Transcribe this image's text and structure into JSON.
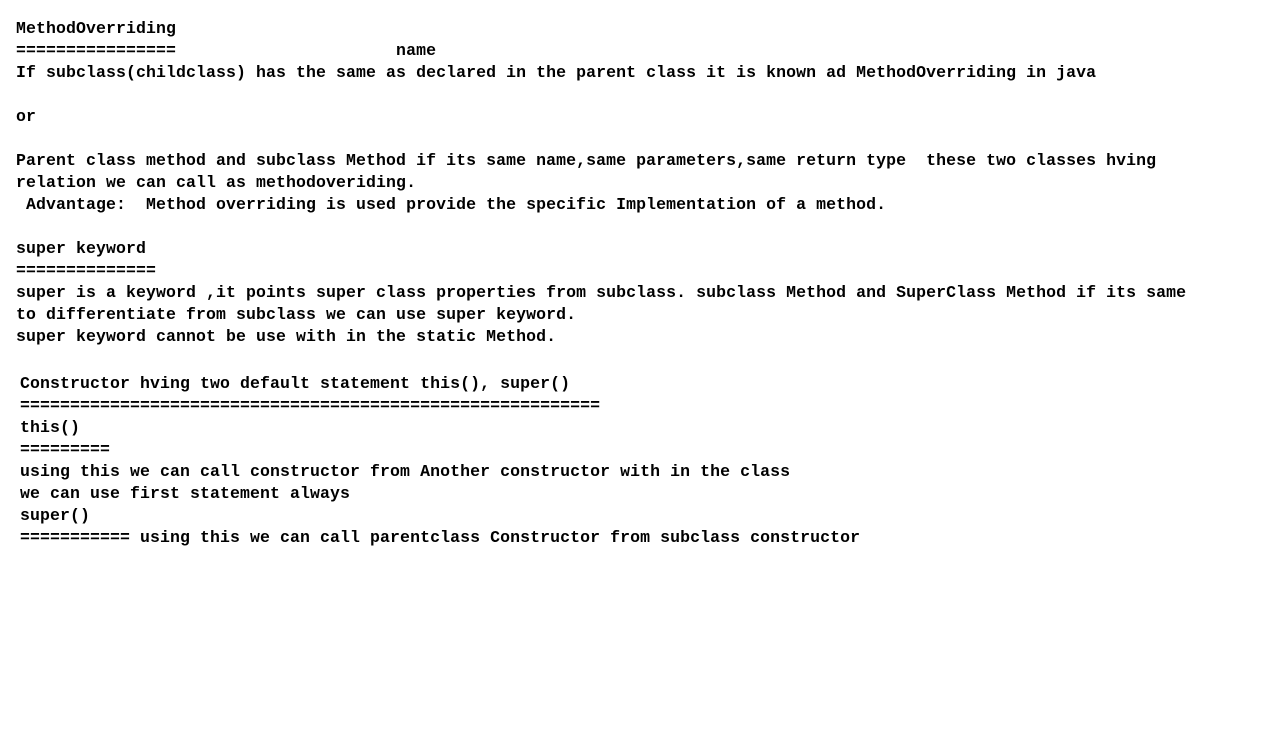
{
  "section1": {
    "title": "MethodOverriding",
    "underline_with_name": "================                      name",
    "definition": "If subclass(childclass) has the same as declared in the parent class it is known ad MethodOverriding in java",
    "or": "or",
    "desc_line1": "Parent class method and subclass Method if its same name,same parameters,same return type  these two classes hving",
    "desc_line2": "relation we can call as methodoveriding.",
    "advantage": " Advantage:  Method overriding is used provide the specific Implementation of a method."
  },
  "section2": {
    "title": "super keyword",
    "underline": "==============",
    "line1": "super is a keyword ,it points super class properties from subclass. subclass Method and SuperClass Method if its same",
    "line2": "to differentiate from subclass we can use super keyword.",
    "line3": "super keyword cannot be use with in the static Method."
  },
  "section3": {
    "title": "Constructor hving two default statement this(), super()",
    "underline": "==========================================================",
    "this_title": "this()",
    "this_underline": "=========",
    "this_line1": "using this we can call constructor from Another constructor with in the class",
    "this_line2": "we can use first statement always",
    "super_title": "super()",
    "super_line": "=========== using this we can call parentclass Constructor from subclass constructor"
  }
}
